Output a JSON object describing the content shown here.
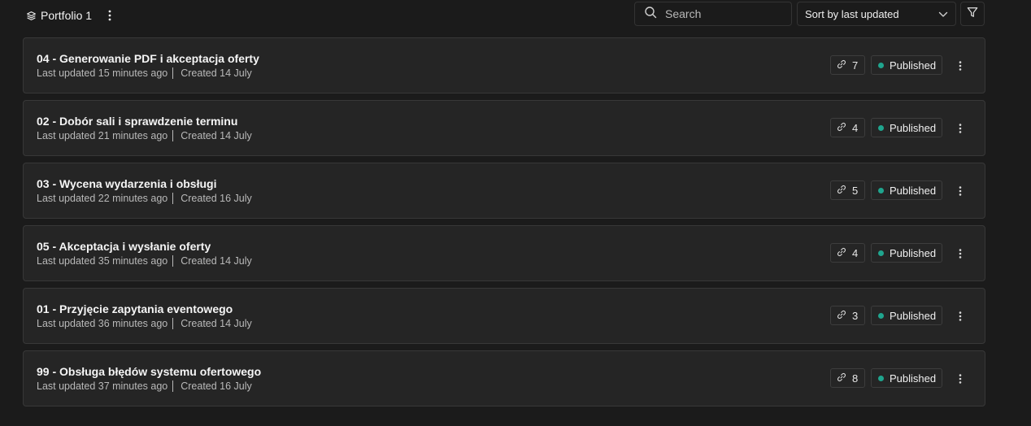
{
  "header": {
    "portfolio_name": "Portfolio 1",
    "portfolio_icon": "layers-icon",
    "more_icon": "more-vertical-icon"
  },
  "search": {
    "placeholder": "Search",
    "value": "",
    "icon": "search-icon"
  },
  "sort": {
    "selected": "Sort by last updated",
    "icon": "chevron-down-icon"
  },
  "filter": {
    "icon": "filter-icon"
  },
  "colors": {
    "published_dot": "#1fa58e",
    "background": "#1b1b1b",
    "card": "#252525"
  },
  "items": [
    {
      "title": "04 - Generowanie PDF i akceptacja oferty",
      "updated": "Last updated 15 minutes ago",
      "created": "Created 14 July",
      "links": "7",
      "status": "Published"
    },
    {
      "title": "02 - Dobór sali i sprawdzenie terminu",
      "updated": "Last updated 21 minutes ago",
      "created": "Created 14 July",
      "links": "4",
      "status": "Published"
    },
    {
      "title": "03 - Wycena wydarzenia i obsługi",
      "updated": "Last updated 22 minutes ago",
      "created": "Created 16 July",
      "links": "5",
      "status": "Published"
    },
    {
      "title": "05 - Akceptacja i wysłanie oferty",
      "updated": "Last updated 35 minutes ago",
      "created": "Created 14 July",
      "links": "4",
      "status": "Published"
    },
    {
      "title": "01 - Przyjęcie zapytania eventowego",
      "updated": "Last updated 36 minutes ago",
      "created": "Created 14 July",
      "links": "3",
      "status": "Published"
    },
    {
      "title": "99 - Obsługa błędów systemu ofertowego",
      "updated": "Last updated 37 minutes ago",
      "created": "Created 16 July",
      "links": "8",
      "status": "Published"
    }
  ]
}
